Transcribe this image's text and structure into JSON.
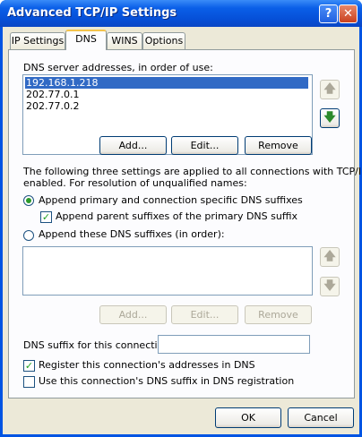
{
  "window": {
    "title": "Advanced TCP/IP Settings",
    "help_glyph": "?",
    "close_glyph": "✕"
  },
  "tabs": [
    {
      "label": "IP Settings"
    },
    {
      "label": "DNS"
    },
    {
      "label": "WINS"
    },
    {
      "label": "Options"
    }
  ],
  "dns": {
    "servers_label": "DNS server addresses, in order of use:",
    "servers": [
      "192.168.1.218",
      "202.77.0.1",
      "202.77.0.2"
    ],
    "add_label": "Add...",
    "edit_label": "Edit...",
    "remove_label": "Remove",
    "info_line1": "The following three settings are applied to all connections with TCP/IP",
    "info_line2": "enabled. For resolution of unqualified names:",
    "radio_primary_label": "Append primary and connection specific DNS suffixes",
    "check_parent_label": "Append parent suffixes of the primary DNS suffix",
    "radio_these_label": "Append these DNS suffixes (in order):",
    "suffix_add_label": "Add...",
    "suffix_edit_label": "Edit...",
    "suffix_remove_label": "Remove",
    "conn_suffix_label": "DNS suffix for this connection:",
    "conn_suffix_value": "",
    "register_label": "Register this connection's addresses in DNS",
    "use_suffix_label": "Use this connection's DNS suffix in DNS registration"
  },
  "footer": {
    "ok_label": "OK",
    "cancel_label": "Cancel"
  },
  "icons": {
    "up": "🡅",
    "down": "🡇"
  },
  "colors": {
    "title_blue": "#0a5fe8",
    "selection": "#316ac5",
    "arrow_green": "#2b8a2b"
  }
}
